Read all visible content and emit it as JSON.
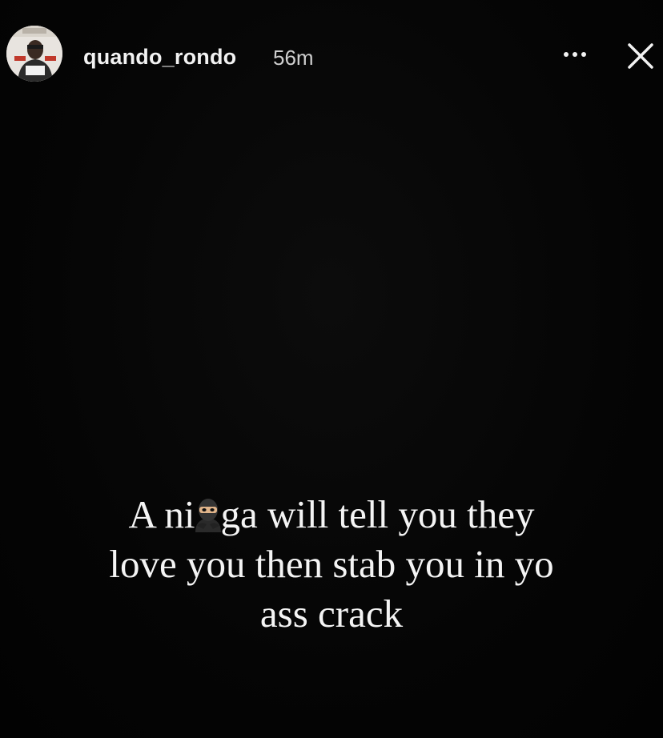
{
  "story": {
    "username": "quando_rondo",
    "timestamp": "56m",
    "caption_line1_before": "A ni",
    "caption_line1_after": "ga will tell you they",
    "caption_line2": "love you then stab you in yo",
    "caption_line3": "ass crack"
  },
  "icons": {
    "avatar": "profile-photo",
    "more": "more-options-icon",
    "close": "close-icon",
    "emoji": "ninja-emoji"
  },
  "colors": {
    "background": "#000000",
    "text": "#f4f4f4"
  }
}
